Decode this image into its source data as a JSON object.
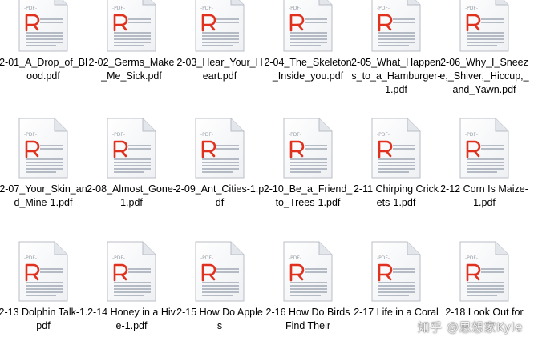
{
  "icons": {
    "file_type_label": "PDF"
  },
  "files": [
    {
      "name": "2-01_A_Drop_of_Blood.pdf"
    },
    {
      "name": "2-02_Germs_Make_Me_Sick.pdf"
    },
    {
      "name": "2-03_Hear_Your_Heart.pdf"
    },
    {
      "name": "2-04_The_Skeleton_Inside_you.pdf"
    },
    {
      "name": "2-05_What_Happens_to_a_Hamburger-1.pdf"
    },
    {
      "name": "2-06_Why_I_Sneeze,_Shiver,_Hiccup,_and_Yawn.pdf"
    },
    {
      "name": "2-07_Your_Skin_and_Mine-1.pdf"
    },
    {
      "name": "2-08_Almost_Gone-1.pdf"
    },
    {
      "name": "2-09_Ant_Cities-1.pdf"
    },
    {
      "name": "2-10_Be_a_Friend_to_Trees-1.pdf"
    },
    {
      "name": "2-11 Chirping Crickets-1.pdf"
    },
    {
      "name": "2-12 Corn Is Maize-1.pdf"
    },
    {
      "name": "2-13 Dolphin Talk-1.pdf"
    },
    {
      "name": "2-14 Honey in a Hive-1.pdf"
    },
    {
      "name": "2-15 How Do Apples"
    },
    {
      "name": "2-16 How Do Birds Find Their"
    },
    {
      "name": "2-17 Life in a Coral"
    },
    {
      "name": "2-18 Look Out for"
    }
  ],
  "watermark": "知乎 @思想家Kyle"
}
